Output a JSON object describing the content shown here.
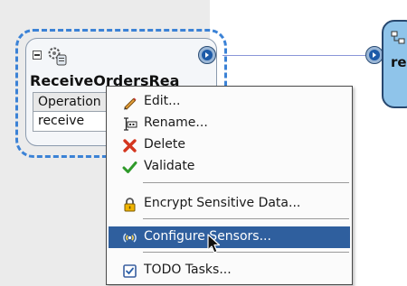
{
  "component": {
    "title": "ReceiveOrdersRea",
    "operation_header": "Operation",
    "operation_value": "receive"
  },
  "target": {
    "label": "re"
  },
  "context_menu": {
    "items": [
      {
        "label": "Edit...",
        "icon": "pencil-icon"
      },
      {
        "label": "Rename...",
        "icon": "rename-icon"
      },
      {
        "label": "Delete",
        "icon": "delete-x-icon"
      },
      {
        "label": "Validate",
        "icon": "checkmark-icon"
      },
      {
        "label": "Encrypt Sensitive Data...",
        "icon": "lock-icon"
      },
      {
        "label": "Configure Sensors...",
        "icon": "sensor-icon",
        "highlighted": true
      },
      {
        "label": "TODO Tasks...",
        "icon": "todo-checkbox-icon"
      }
    ]
  },
  "colors": {
    "selection_border": "#3b82d6",
    "menu_highlight": "#2f5f9e",
    "swimlane_background": "#ebebeb",
    "target_fill": "#8fc4ea"
  }
}
